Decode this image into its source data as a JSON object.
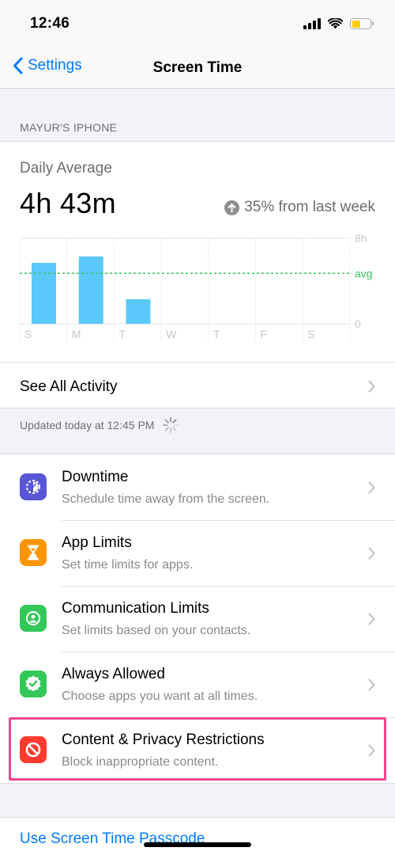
{
  "status_bar": {
    "time": "12:46"
  },
  "nav": {
    "back_label": "Settings",
    "title": "Screen Time"
  },
  "device": {
    "header": "MAYUR'S IPHONE"
  },
  "summary": {
    "label": "Daily Average",
    "value": "4h 43m",
    "trend_text": "35% from last week",
    "trend_direction": "up"
  },
  "chart_data": {
    "type": "bar",
    "categories": [
      "S",
      "M",
      "T",
      "W",
      "T",
      "F",
      "S"
    ],
    "values": [
      5.7,
      6.3,
      2.3,
      0,
      0,
      0,
      0
    ],
    "average": 4.72,
    "average_label": "avg",
    "ylim": [
      0,
      8
    ],
    "y_top_label": "8h",
    "y_bottom_label": "0",
    "bar_color": "#5ac8fa",
    "avg_color": "#34c759"
  },
  "see_all": {
    "label": "See All Activity"
  },
  "updated": {
    "text": "Updated today at 12:45 PM"
  },
  "items": [
    {
      "title": "Downtime",
      "subtitle": "Schedule time away from the screen.",
      "icon": "downtime-icon",
      "color": "#5856d6"
    },
    {
      "title": "App Limits",
      "subtitle": "Set time limits for apps.",
      "icon": "hourglass-icon",
      "color": "#ff9500"
    },
    {
      "title": "Communication Limits",
      "subtitle": "Set limits based on your contacts.",
      "icon": "contact-icon",
      "color": "#34c759"
    },
    {
      "title": "Always Allowed",
      "subtitle": "Choose apps you want at all times.",
      "icon": "checkmark-badge-icon",
      "color": "#34c759"
    },
    {
      "title": "Content & Privacy Restrictions",
      "subtitle": "Block inappropriate content.",
      "icon": "restriction-icon",
      "color": "#ff3b30"
    }
  ],
  "passcode": {
    "label": "Use Screen Time Passcode"
  },
  "colors": {
    "accent": "#007aff",
    "highlight": "#f0468f"
  }
}
